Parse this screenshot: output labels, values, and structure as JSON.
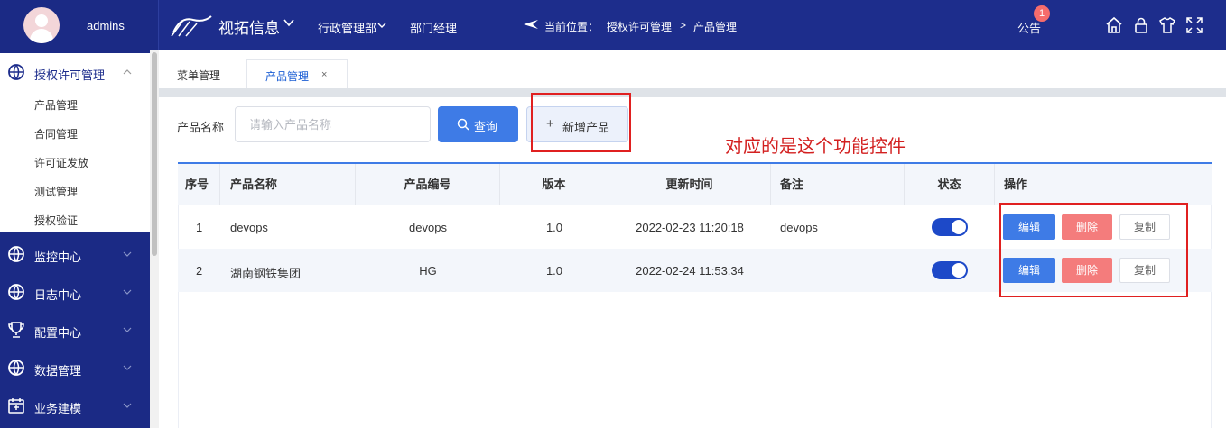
{
  "header": {
    "username": "admins",
    "brand": "视拓信息",
    "nav": [
      "行政管理部",
      "部门经理"
    ],
    "location_label": "当前位置：",
    "location_path": [
      "授权许可管理",
      "产品管理"
    ],
    "location_sep": ">",
    "notice_label": "公告",
    "notice_count": "1"
  },
  "sidebar": {
    "groups": [
      {
        "label": "授权许可管理",
        "icon": "globe-icon",
        "expanded": true
      },
      {
        "label": "监控中心",
        "icon": "globe-icon"
      },
      {
        "label": "日志中心",
        "icon": "globe-icon"
      },
      {
        "label": "配置中心",
        "icon": "trophy-icon"
      },
      {
        "label": "数据管理",
        "icon": "globe-icon"
      },
      {
        "label": "业务建模",
        "icon": "calendar-icon"
      }
    ],
    "sub_items": [
      "产品管理",
      "合同管理",
      "许可证发放",
      "测试管理",
      "授权验证"
    ]
  },
  "tabs": [
    {
      "label": "菜单管理"
    },
    {
      "label": "产品管理",
      "active": true,
      "close": "×"
    }
  ],
  "search": {
    "label": "产品名称",
    "placeholder": "请输入产品名称",
    "query_button": "查询",
    "add_button": "新增产品"
  },
  "annotation": "对应的是这个功能控件",
  "table": {
    "columns": [
      "序号",
      "产品名称",
      "产品编号",
      "版本",
      "更新时间",
      "备注",
      "状态",
      "操作"
    ],
    "rows": [
      {
        "index": "1",
        "name": "devops",
        "code": "devops",
        "version": "1.0",
        "updated": "2022-02-23 11:20:18",
        "remark": "devops",
        "status": true
      },
      {
        "index": "2",
        "name": "湖南钢铁集团",
        "code": "HG",
        "version": "1.0",
        "updated": "2022-02-24 11:53:34",
        "remark": "",
        "status": true
      }
    ],
    "actions": {
      "edit": "编辑",
      "delete": "删除",
      "copy": "复制"
    }
  },
  "colors": {
    "topbar": "#1d2d8c",
    "primary": "#3e7be6",
    "danger": "#f47c7c",
    "highlight": "#e02020"
  }
}
